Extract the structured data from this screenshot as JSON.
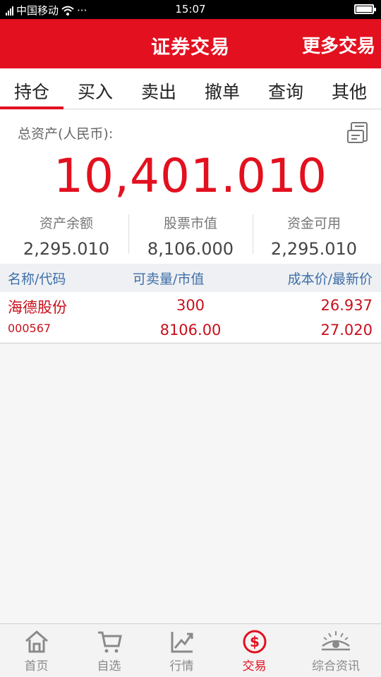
{
  "status_bar": {
    "carrier": "中国移动",
    "dots": "···",
    "time": "15:07"
  },
  "header": {
    "title": "证券交易",
    "more_label": "更多交易"
  },
  "tabs": [
    {
      "label": "持仓",
      "active": true
    },
    {
      "label": "买入"
    },
    {
      "label": "卖出"
    },
    {
      "label": "撤单"
    },
    {
      "label": "查询"
    },
    {
      "label": "其他"
    }
  ],
  "assets": {
    "total_label": "总资产(人民币):",
    "total_value": "10,401.010",
    "stats": [
      {
        "label": "资产余额",
        "value": "2,295.010"
      },
      {
        "label": "股票市值",
        "value": "8,106.000"
      },
      {
        "label": "资金可用",
        "value": "2,295.010"
      }
    ]
  },
  "table": {
    "headers": [
      "名称/代码",
      "可卖量/市值",
      "成本价/最新价"
    ],
    "rows": [
      {
        "name": "海德股份",
        "code": "000567",
        "sellable": "300",
        "market_value": "8106.00",
        "cost_price": "26.937",
        "latest_price": "27.020"
      }
    ]
  },
  "bottom_nav": [
    {
      "label": "首页",
      "icon": "home-icon"
    },
    {
      "label": "自选",
      "icon": "cart-icon"
    },
    {
      "label": "行情",
      "icon": "chart-icon"
    },
    {
      "label": "交易",
      "icon": "dollar-icon",
      "active": true
    },
    {
      "label": "综合资讯",
      "icon": "eye-icon"
    }
  ],
  "colors": {
    "brand_red": "#e3101f",
    "header_blue": "#3f6fa8"
  }
}
